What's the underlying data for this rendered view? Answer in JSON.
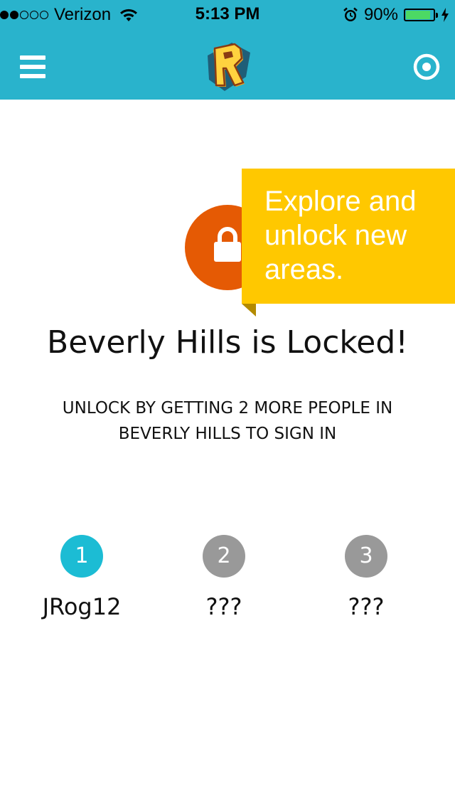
{
  "status_bar": {
    "carrier": "Verizon",
    "signal_bars_filled": 2,
    "signal_bars_total": 5,
    "time": "5:13 PM",
    "battery_percent": "90%",
    "battery_level": 0.9,
    "battery_color": "#4CD964",
    "icons": [
      "wifi-icon",
      "alarm-icon",
      "charging-bolt-icon"
    ]
  },
  "nav": {
    "menu_icon": "hamburger-menu-icon",
    "logo_letter": "R",
    "right_icon": "target-icon",
    "color": "#29B3CC"
  },
  "tooltip": {
    "text": "Explore and unlock new areas.",
    "color": "#FFC800"
  },
  "lock": {
    "icon": "padlock-icon",
    "color": "#E55A04"
  },
  "main": {
    "title": "Beverly Hills is Locked!",
    "subtitle": "UNLOCK BY GETTING 2 MORE PEOPLE IN BEVERLY HILLS TO SIGN IN"
  },
  "slots": [
    {
      "number": "1",
      "name": "JRog12",
      "active": true
    },
    {
      "number": "2",
      "name": "???",
      "active": false
    },
    {
      "number": "3",
      "name": "???",
      "active": false
    }
  ],
  "colors": {
    "active_slot": "#1CBCD4",
    "inactive_slot": "#999999"
  }
}
